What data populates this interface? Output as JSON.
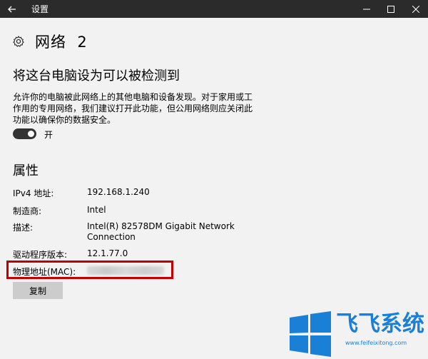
{
  "window": {
    "title": "设置"
  },
  "page": {
    "title": "网络  2"
  },
  "discoverable": {
    "heading": "将这台电脑设为可以被检测到",
    "description": "允许你的电脑被此网络上的其他电脑和设备发现。对于家用或工作用的专用网络，我们建议打开此功能，但公用网络则应关闭此功能以确保你的数据安全。",
    "toggle_state": "开",
    "toggle_on": true
  },
  "properties": {
    "heading": "属性",
    "rows": [
      {
        "label": "IPv4 地址:",
        "value": "192.168.1.240"
      },
      {
        "label": "制造商:",
        "value": "Intel"
      },
      {
        "label": "描述:",
        "value": "Intel(R) 82578DM Gigabit Network Connection"
      },
      {
        "label": "驱动程序版本:",
        "value": "12.1.77.0"
      },
      {
        "label": "物理地址(MAC):",
        "value": ""
      }
    ],
    "copy_label": "复制"
  },
  "watermark": {
    "brand": "飞飞系统",
    "url": "www.feifeixitong.com"
  },
  "colors": {
    "titlebar": "#2b2b2b",
    "background": "#f2f2f2",
    "highlight": "#c00000",
    "watermark": "#1a7fd6"
  }
}
